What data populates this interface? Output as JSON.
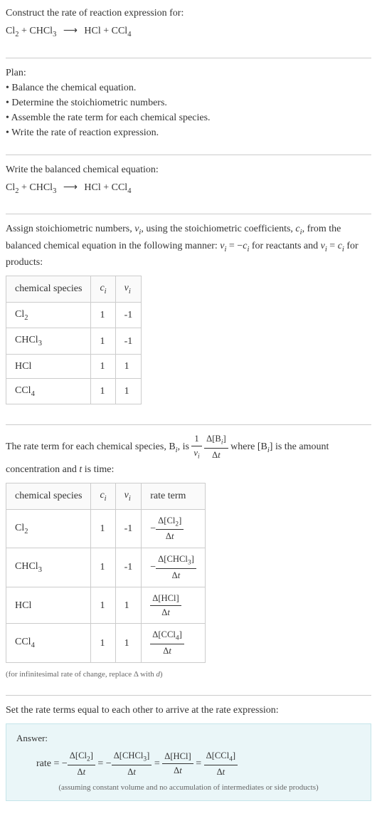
{
  "intro": {
    "title": "Construct the rate of reaction expression for:",
    "equation": "Cl₂ + CHCl₃  ⟶  HCl + CCl₄"
  },
  "plan": {
    "heading": "Plan:",
    "items": [
      "Balance the chemical equation.",
      "Determine the stoichiometric numbers.",
      "Assemble the rate term for each chemical species.",
      "Write the rate of reaction expression."
    ]
  },
  "balanced": {
    "heading": "Write the balanced chemical equation:",
    "equation": "Cl₂ + CHCl₃  ⟶  HCl + CCl₄"
  },
  "stoich_intro": "Assign stoichiometric numbers, νᵢ, using the stoichiometric coefficients, cᵢ, from the balanced chemical equation in the following manner: νᵢ = −cᵢ for reactants and νᵢ = cᵢ for products:",
  "table1": {
    "headers": [
      "chemical species",
      "cᵢ",
      "νᵢ"
    ],
    "rows": [
      {
        "species": "Cl₂",
        "c": "1",
        "v": "-1"
      },
      {
        "species": "CHCl₃",
        "c": "1",
        "v": "-1"
      },
      {
        "species": "HCl",
        "c": "1",
        "v": "1"
      },
      {
        "species": "CCl₄",
        "c": "1",
        "v": "1"
      }
    ]
  },
  "rate_term_intro_a": "The rate term for each chemical species, Bᵢ, is ",
  "rate_term_intro_b": " where [Bᵢ] is the amount concentration and t is time:",
  "table2": {
    "headers": [
      "chemical species",
      "cᵢ",
      "νᵢ",
      "rate term"
    ],
    "rows": [
      {
        "species": "Cl₂",
        "c": "1",
        "v": "-1",
        "rate_num": "Δ[Cl₂]",
        "rate_den": "Δt",
        "neg": true
      },
      {
        "species": "CHCl₃",
        "c": "1",
        "v": "-1",
        "rate_num": "Δ[CHCl₃]",
        "rate_den": "Δt",
        "neg": true
      },
      {
        "species": "HCl",
        "c": "1",
        "v": "1",
        "rate_num": "Δ[HCl]",
        "rate_den": "Δt",
        "neg": false
      },
      {
        "species": "CCl₄",
        "c": "1",
        "v": "1",
        "rate_num": "Δ[CCl₄]",
        "rate_den": "Δt",
        "neg": false
      }
    ]
  },
  "infinitesimal_note": "(for infinitesimal rate of change, replace Δ with d)",
  "set_equal": "Set the rate terms equal to each other to arrive at the rate expression:",
  "answer": {
    "label": "Answer:",
    "prefix": "rate = ",
    "terms": [
      {
        "neg": true,
        "num": "Δ[Cl₂]",
        "den": "Δt"
      },
      {
        "neg": true,
        "num": "Δ[CHCl₃]",
        "den": "Δt"
      },
      {
        "neg": false,
        "num": "Δ[HCl]",
        "den": "Δt"
      },
      {
        "neg": false,
        "num": "Δ[CCl₄]",
        "den": "Δt"
      }
    ],
    "note": "(assuming constant volume and no accumulation of intermediates or side products)"
  }
}
